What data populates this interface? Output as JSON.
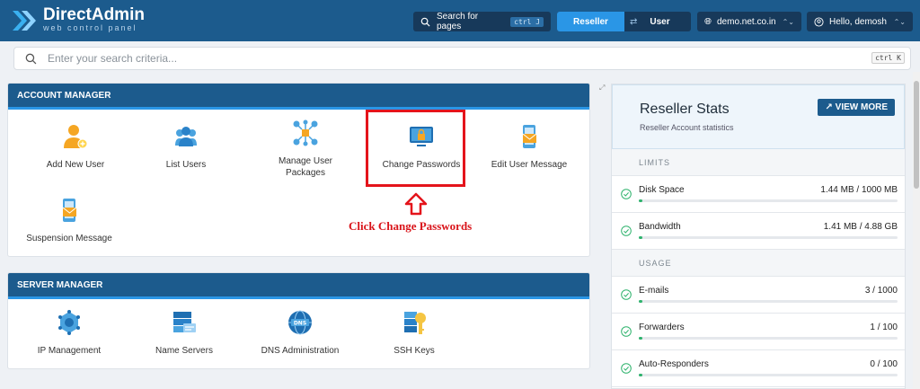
{
  "app": {
    "title": "DirectAdmin",
    "subtitle": "web control panel"
  },
  "topbar": {
    "search_label": "Search for pages",
    "search_kbd": "ctrl J",
    "role_active": "Reseller",
    "role_other": "User",
    "domain": "demo.net.co.in",
    "greeting": "Hello, demosh"
  },
  "search": {
    "placeholder": "Enter your search criteria...",
    "kbd": "ctrl K"
  },
  "account_manager": {
    "title": "ACCOUNT MANAGER",
    "items": [
      {
        "label": "Add New User"
      },
      {
        "label": "List Users"
      },
      {
        "label": "Manage User Packages"
      },
      {
        "label": "Change Passwords"
      },
      {
        "label": "Edit User Message"
      },
      {
        "label": "Suspension Message"
      }
    ]
  },
  "server_manager": {
    "title": "SERVER MANAGER",
    "items": [
      {
        "label": "IP Management"
      },
      {
        "label": "Name Servers"
      },
      {
        "label": "DNS Administration"
      },
      {
        "label": "SSH Keys"
      }
    ]
  },
  "annotation": {
    "text": "Click Change Passwords"
  },
  "stats": {
    "title": "Reseller Stats",
    "subtitle": "Reseller Account statistics",
    "view_more": "VIEW MORE",
    "limits_label": "LIMITS",
    "usage_label": "USAGE",
    "limits": [
      {
        "name": "Disk Space",
        "value": "1.44 MB / 1000 MB",
        "fill": 0.01
      },
      {
        "name": "Bandwidth",
        "value": "1.41 MB / 4.88 GB",
        "fill": 0.01
      }
    ],
    "usage": [
      {
        "name": "E-mails",
        "value": "3 / 1000",
        "fill": 0.01
      },
      {
        "name": "Forwarders",
        "value": "1 / 100",
        "fill": 0.01
      },
      {
        "name": "Auto-Responders",
        "value": "0 / 100",
        "fill": 0.01
      }
    ]
  },
  "colors": {
    "brand": "#1c5b8d",
    "accent": "#2a96e6",
    "highlight": "#e4141b",
    "progress": "#2fb36d"
  }
}
